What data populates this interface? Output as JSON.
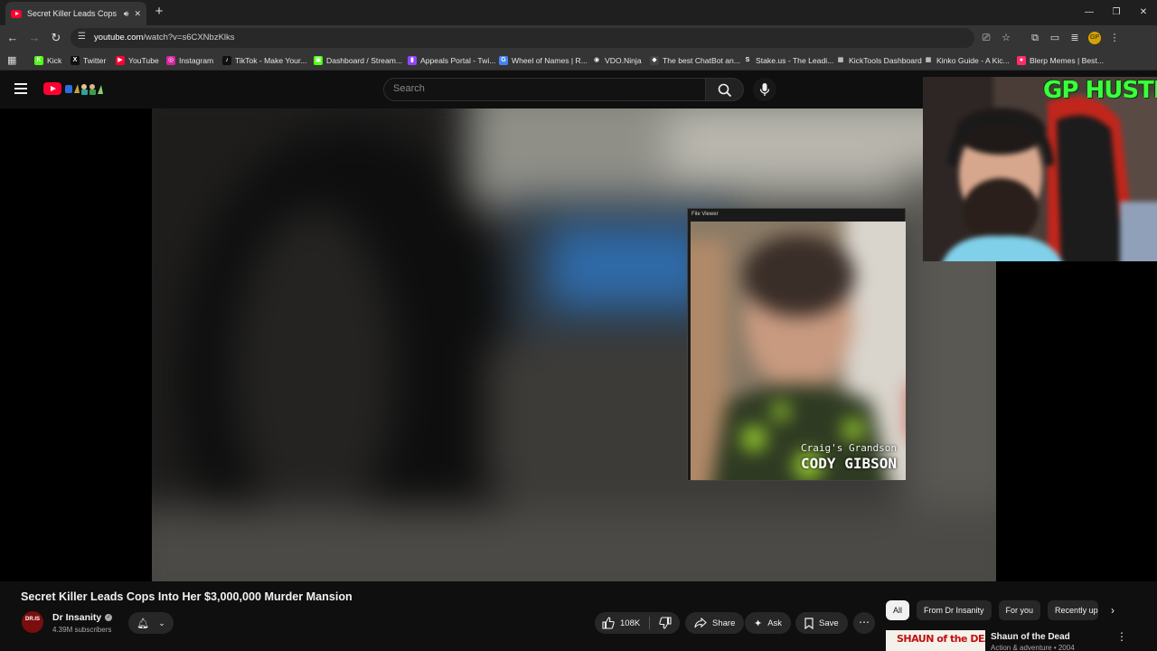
{
  "browser": {
    "tab_title": "Secret Killer Leads Cops Int",
    "new_tab": "+",
    "url_host": "youtube.com",
    "url_path": "/watch?v=s6CXNbzKlks"
  },
  "bookmarks": [
    {
      "label": "Kick",
      "color": "#53fc18",
      "glyph": "K"
    },
    {
      "label": "Twitter",
      "color": "#111111",
      "glyph": "X"
    },
    {
      "label": "YouTube",
      "color": "#ff0033",
      "glyph": "▶"
    },
    {
      "label": "Instagram",
      "color": "#d6249f",
      "glyph": "◎"
    },
    {
      "label": "TikTok - Make Your...",
      "color": "#111111",
      "glyph": "♪"
    },
    {
      "label": "Dashboard / Stream...",
      "color": "#53fc18",
      "glyph": "▣"
    },
    {
      "label": "Appeals Portal - Twi...",
      "color": "#9146ff",
      "glyph": "▮"
    },
    {
      "label": "Wheel of Names | R...",
      "color": "#4285f4",
      "glyph": "G"
    },
    {
      "label": "VDO.Ninja",
      "color": "#333333",
      "glyph": "◉"
    },
    {
      "label": "The best ChatBot an...",
      "color": "#444444",
      "glyph": "◆"
    },
    {
      "label": "Stake.us - The Leadi...",
      "color": "#353535",
      "glyph": "S"
    },
    {
      "label": "KickTools Dashboard",
      "color": "#353535",
      "glyph": "▦"
    },
    {
      "label": "Kinko Guide - A Kic...",
      "color": "#353535",
      "glyph": "▦"
    },
    {
      "label": "Blerp Memes | Best...",
      "color": "#ff2d6a",
      "glyph": "●"
    }
  ],
  "masthead": {
    "search_placeholder": "Search"
  },
  "player": {
    "file_viewer_title": "File Viewer",
    "caption_sub": "Craig's Grandson",
    "caption_name": "CODY GIBSON"
  },
  "overlay": {
    "cam_title": "GP HUSTLA"
  },
  "video": {
    "title": "Secret Killer Leads Cops Into Her $3,000,000 Murder Mansion",
    "channel": "Dr Insanity",
    "avatar_text": "DR.IS",
    "subscribers": "4.39M subscribers",
    "likes": "108K",
    "share": "Share",
    "ask": "Ask",
    "save": "Save"
  },
  "chips": [
    "All",
    "From Dr Insanity",
    "For you",
    "Recently up"
  ],
  "recommendation": {
    "thumb_text": "SHAUN of the DEAD",
    "title": "Shaun of the Dead",
    "meta": "Action & adventure • 2004"
  },
  "colors": {
    "accent": "#ff0033",
    "cam_title": "#3cff3c",
    "background": "#0f0f0f"
  }
}
